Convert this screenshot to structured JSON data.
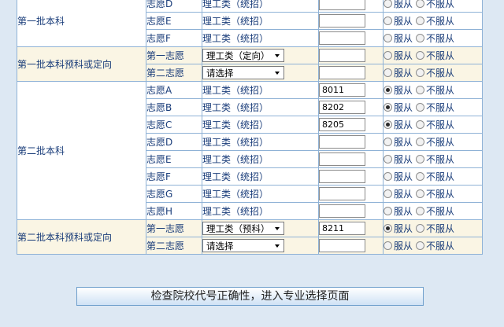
{
  "groups": [
    {
      "batch": "第一批本科",
      "type": "plain",
      "rows": [
        {
          "choice": "志愿D",
          "category": "理工类（统招）",
          "code": "",
          "obey": false
        },
        {
          "choice": "志愿E",
          "category": "理工类（统招）",
          "code": "",
          "obey": false
        },
        {
          "choice": "志愿F",
          "category": "理工类（统招）",
          "code": "",
          "obey": false
        }
      ]
    },
    {
      "batch": "第一批本科预科或定向",
      "type": "select",
      "rows": [
        {
          "choice": "第一志愿",
          "category": "理工类（定向）",
          "code": "",
          "obey": false
        },
        {
          "choice": "第二志愿",
          "category": "请选择",
          "code": "",
          "obey": false
        }
      ]
    },
    {
      "batch": "第二批本科",
      "type": "plain",
      "rows": [
        {
          "choice": "志愿A",
          "category": "理工类（统招）",
          "code": "8011",
          "obey": true
        },
        {
          "choice": "志愿B",
          "category": "理工类（统招）",
          "code": "8202",
          "obey": true
        },
        {
          "choice": "志愿C",
          "category": "理工类（统招）",
          "code": "8205",
          "obey": true
        },
        {
          "choice": "志愿D",
          "category": "理工类（统招）",
          "code": "",
          "obey": false
        },
        {
          "choice": "志愿E",
          "category": "理工类（统招）",
          "code": "",
          "obey": false
        },
        {
          "choice": "志愿F",
          "category": "理工类（统招）",
          "code": "",
          "obey": false
        },
        {
          "choice": "志愿G",
          "category": "理工类（统招）",
          "code": "",
          "obey": false
        },
        {
          "choice": "志愿H",
          "category": "理工类（统招）",
          "code": "",
          "obey": false
        }
      ]
    },
    {
      "batch": "第二批本科预科或定向",
      "type": "select",
      "rows": [
        {
          "choice": "第一志愿",
          "category": "理工类（预科）",
          "code": "8211",
          "obey": true
        },
        {
          "choice": "第二志愿",
          "category": "请选择",
          "code": "",
          "obey": false
        }
      ]
    }
  ],
  "labels": {
    "obey": "服从",
    "not_obey": "不服从"
  },
  "submit_label": "检查院校代号正确性，进入专业选择页面",
  "colors": {
    "border": "#8fb2d6",
    "text": "#1a3d7a",
    "cream": "#faf5e4",
    "page_bg": "#dde8f3"
  }
}
